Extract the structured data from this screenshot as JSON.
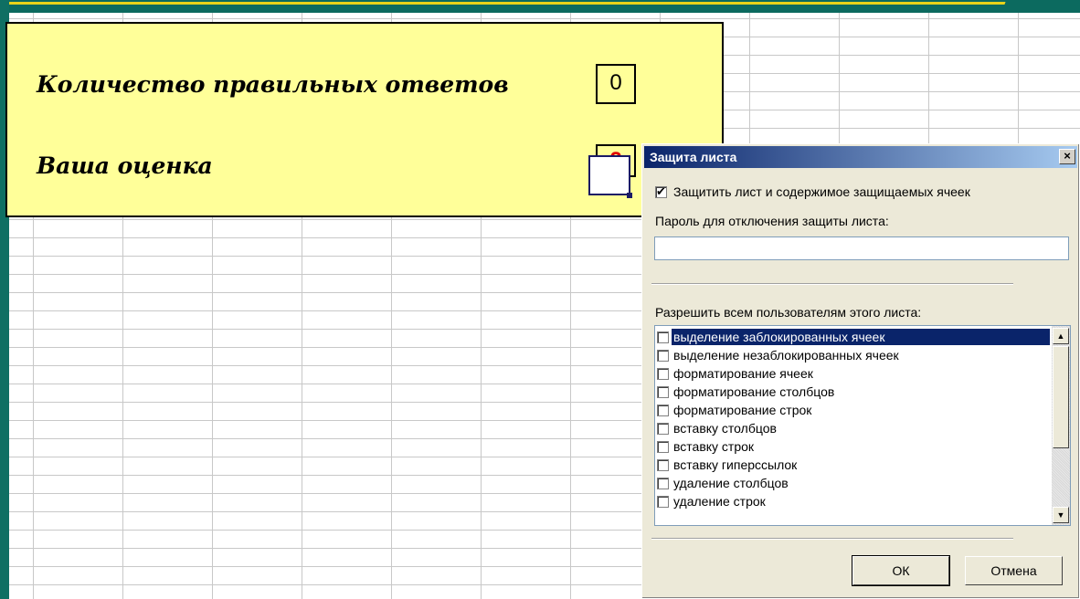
{
  "quiz": {
    "correct_answers_label": "Количество правильных ответов",
    "correct_answers_value": "0",
    "grade_label": "Ваша оценка",
    "grade_value": "2",
    "grade_color": "#e00000",
    "panel_color": "#ffff99"
  },
  "dialog": {
    "title": "Защита листа",
    "close_glyph": "×",
    "protect_checkbox": {
      "label": "Защитить лист и содержимое защищаемых ячеек",
      "checked": true
    },
    "password_label": "Пароль для отключения защиты листа:",
    "password_value": "",
    "allow_label": "Разрешить всем пользователям этого листа:",
    "permissions": [
      {
        "label": "выделение заблокированных ячеек",
        "checked": false,
        "selected": true
      },
      {
        "label": "выделение незаблокированных ячеек",
        "checked": false,
        "selected": false
      },
      {
        "label": "форматирование ячеек",
        "checked": false,
        "selected": false
      },
      {
        "label": "форматирование столбцов",
        "checked": false,
        "selected": false
      },
      {
        "label": "форматирование строк",
        "checked": false,
        "selected": false
      },
      {
        "label": "вставку столбцов",
        "checked": false,
        "selected": false
      },
      {
        "label": "вставку строк",
        "checked": false,
        "selected": false
      },
      {
        "label": "вставку гиперссылок",
        "checked": false,
        "selected": false
      },
      {
        "label": "удаление столбцов",
        "checked": false,
        "selected": false
      },
      {
        "label": "удаление строк",
        "checked": false,
        "selected": false
      }
    ],
    "ok_label": "ОК",
    "cancel_label": "Отмена",
    "titlebar_color": "#0a246a",
    "selection_color": "#0a246a"
  },
  "background_color": "#0f6f63",
  "accent_line_color": "#e9d21a"
}
